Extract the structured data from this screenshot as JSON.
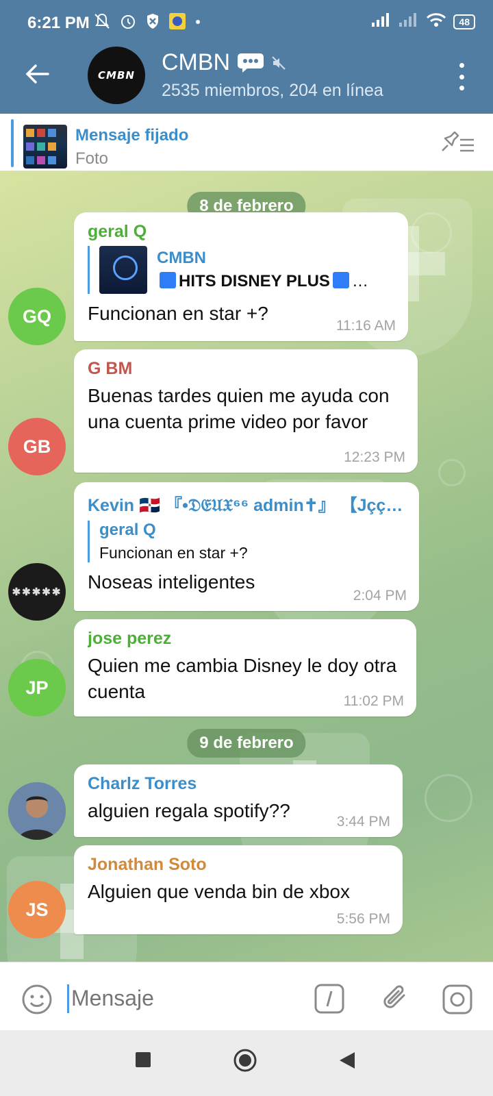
{
  "status_bar": {
    "time": "6:21 PM",
    "battery": "48"
  },
  "header": {
    "avatar_text": "CMBN",
    "title": "CMBN",
    "subtitle": "2535 miembros, 204 en línea"
  },
  "pinned": {
    "title": "Mensaje fijado",
    "subtitle": "Foto"
  },
  "dates": [
    "8 de febrero",
    "9 de febrero"
  ],
  "messages": [
    {
      "initials": "GQ",
      "sender": "geral Q",
      "sender_color": "#4fae3a",
      "avatar_color": "#6bc94b",
      "reply_name": "CMBN",
      "reply_text": "HITS DISNEY PLUS",
      "reply_suffix": "…",
      "text": "Funcionan en star +?",
      "time": "11:16 AM"
    },
    {
      "initials": "GB",
      "sender": "G BM",
      "sender_color": "#c0564c",
      "avatar_color": "#e6655a",
      "text": "Buenas tardes quien me ayuda con una cuenta prime video por favor",
      "time": "12:23 PM"
    },
    {
      "initials": "",
      "sender": "Kevin 🇩🇴  『•𝔇𝔈𝔘𝔛⁶⁶ admin✝』 【Jçç…",
      "sender_color": "#3b8ec9",
      "avatar_color": "#1b1b1b",
      "reply_name": "geral Q",
      "reply_text": "Funcionan en star +?",
      "text": "Noseas inteligentes",
      "time": "2:04 PM"
    },
    {
      "initials": "JP",
      "sender": "jose perez",
      "sender_color": "#4fae3a",
      "avatar_color": "#6bc94b",
      "text": "Quien me cambia Disney le doy otra cuenta",
      "time": "11:02 PM"
    },
    {
      "initials": "",
      "sender": "Charlz Torres",
      "sender_color": "#3b8ec9",
      "avatar_color": "#6a7c93",
      "text": "alguien regala spotify??",
      "time": "3:44 PM"
    },
    {
      "initials": "JS",
      "sender": "Jonathan Soto",
      "sender_color": "#d18a3b",
      "avatar_color": "#ee8c4e",
      "text": "Alguien que venda bin de xbox",
      "time": "5:56 PM"
    }
  ],
  "input": {
    "placeholder": "Mensaje"
  }
}
